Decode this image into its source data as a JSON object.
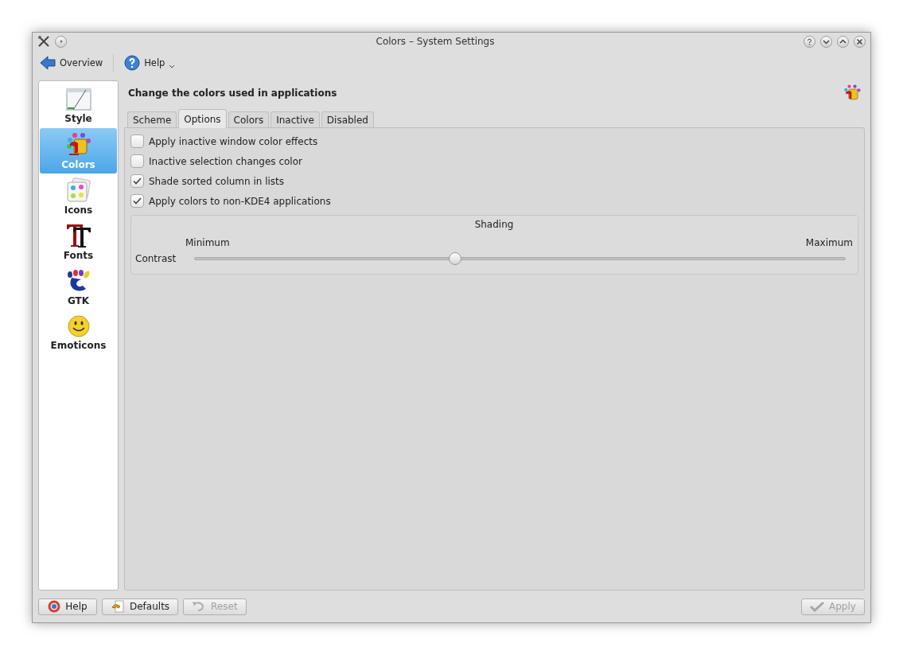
{
  "window": {
    "title": "Colors – System Settings"
  },
  "toolbar": {
    "items": [
      {
        "label": "Overview",
        "kind": "back"
      },
      {
        "label": "Help",
        "kind": "help"
      }
    ]
  },
  "sidebar": {
    "items": [
      {
        "label": "Style",
        "kind": "style",
        "selected": false
      },
      {
        "label": "Colors",
        "kind": "colors",
        "selected": true
      },
      {
        "label": "Icons",
        "kind": "icons",
        "selected": false
      },
      {
        "label": "Fonts",
        "kind": "fonts",
        "selected": false
      },
      {
        "label": "GTK",
        "kind": "gtk",
        "selected": false
      },
      {
        "label": "Emoticons",
        "kind": "emoticons",
        "selected": false
      }
    ]
  },
  "header": {
    "title": "Change the colors used in applications"
  },
  "tabs": [
    {
      "label": "Scheme",
      "selected": false
    },
    {
      "label": "Options",
      "selected": true
    },
    {
      "label": "Colors",
      "selected": false
    },
    {
      "label": "Inactive",
      "selected": false
    },
    {
      "label": "Disabled",
      "selected": false
    }
  ],
  "options": [
    {
      "label": "Apply inactive window color effects",
      "checked": false
    },
    {
      "label": "Inactive selection changes color",
      "checked": false
    },
    {
      "label": "Shade sorted column in lists",
      "checked": true
    },
    {
      "label": "Apply colors to non-KDE4 applications",
      "checked": true
    }
  ],
  "shading": {
    "title": "Shading",
    "min_label": "Minimum",
    "max_label": "Maximum",
    "row_label": "Contrast",
    "level": 0.4
  },
  "buttons": [
    {
      "label": "Help",
      "kind": "help",
      "disabled": false
    },
    {
      "label": "Defaults",
      "kind": "defaults",
      "disabled": false
    },
    {
      "label": "Reset",
      "kind": "reset",
      "disabled": true
    },
    {
      "label": "Apply",
      "kind": "apply",
      "disabled": true
    }
  ]
}
